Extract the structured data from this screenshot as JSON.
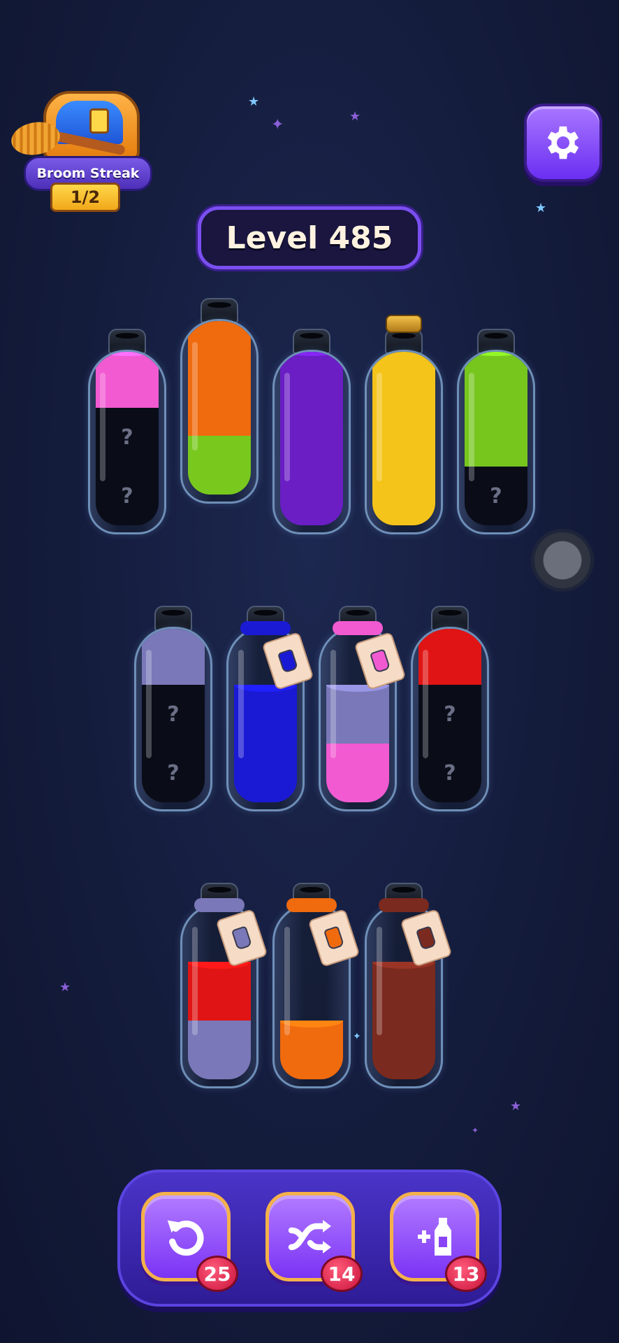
{
  "header": {
    "broom_streak": {
      "label": "Broom Streak",
      "count": "1/2"
    },
    "level_label": "Level 485",
    "settings_icon": "gear-icon"
  },
  "colors": {
    "pink": "#f25ad2",
    "orange": "#f06a0e",
    "lime": "#78c81e",
    "purple": "#6a1ec4",
    "yellow": "#f5c41a",
    "green": "#76c61e",
    "lavender": "#7a78b8",
    "blue": "#1a1ad4",
    "red": "#e01414",
    "brown": "#7a2a1e",
    "hidden": "#0a0d18"
  },
  "bottles": [
    {
      "row": 1,
      "layers": [
        "hidden",
        "hidden",
        "pink"
      ],
      "hidden_mark": "?"
    },
    {
      "row": 1,
      "layers": [
        "lime",
        "orange",
        "orange",
        "orange"
      ]
    },
    {
      "row": 1,
      "layers": [
        "purple",
        "purple",
        "purple"
      ]
    },
    {
      "row": 1,
      "layers": [
        "yellow",
        "yellow",
        "yellow",
        "yellow"
      ],
      "corked": true
    },
    {
      "row": 1,
      "layers": [
        "hidden",
        "green",
        "green"
      ],
      "hidden_mark": "?"
    },
    {
      "row": 2,
      "layers": [
        "hidden",
        "hidden",
        "lavender",
        "lavender"
      ],
      "hidden_mark": "?"
    },
    {
      "row": 2,
      "layers": [
        "blue",
        "blue"
      ],
      "tag_color": "blue"
    },
    {
      "row": 2,
      "layers": [
        "pink",
        "lavender"
      ],
      "tag_color": "pink"
    },
    {
      "row": 2,
      "layers": [
        "hidden",
        "hidden",
        "red",
        "red"
      ],
      "hidden_mark": "?"
    },
    {
      "row": 3,
      "layers": [
        "lavender",
        "red"
      ],
      "tag_color": "lavender"
    },
    {
      "row": 3,
      "layers": [
        "orange"
      ],
      "tag_color": "orange"
    },
    {
      "row": 3,
      "layers": [
        "brown",
        "brown"
      ],
      "tag_color": "brown"
    }
  ],
  "powerups": [
    {
      "name": "undo",
      "icon": "undo-icon",
      "count": "25"
    },
    {
      "name": "shuffle",
      "icon": "shuffle-icon",
      "count": "14"
    },
    {
      "name": "add-bottle",
      "icon": "add-bottle-icon",
      "count": "13"
    }
  ]
}
